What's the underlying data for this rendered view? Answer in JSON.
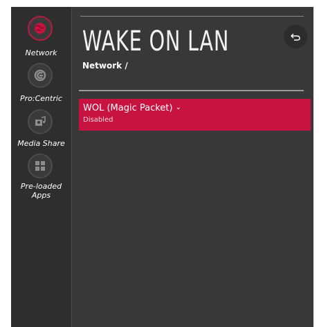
{
  "sidebar": {
    "items": [
      {
        "label": "Network",
        "icon": "network-globe-icon",
        "active": true
      },
      {
        "label": "Pro:Centric",
        "icon": "procentric-icon",
        "active": false
      },
      {
        "label": "Media Share",
        "icon": "media-share-icon",
        "active": false
      },
      {
        "label": "Pre-loaded Apps",
        "icon": "apps-grid-icon",
        "active": false
      }
    ]
  },
  "header": {
    "title": "WAKE ON LAN",
    "breadcrumb": "Network /"
  },
  "options": [
    {
      "label": "WOL (Magic Packet)",
      "chevron": "⌄",
      "value": "Disabled"
    }
  ],
  "colors": {
    "accent": "#c8123f",
    "background": "#383838",
    "sidebar": "#2e2e2e"
  }
}
